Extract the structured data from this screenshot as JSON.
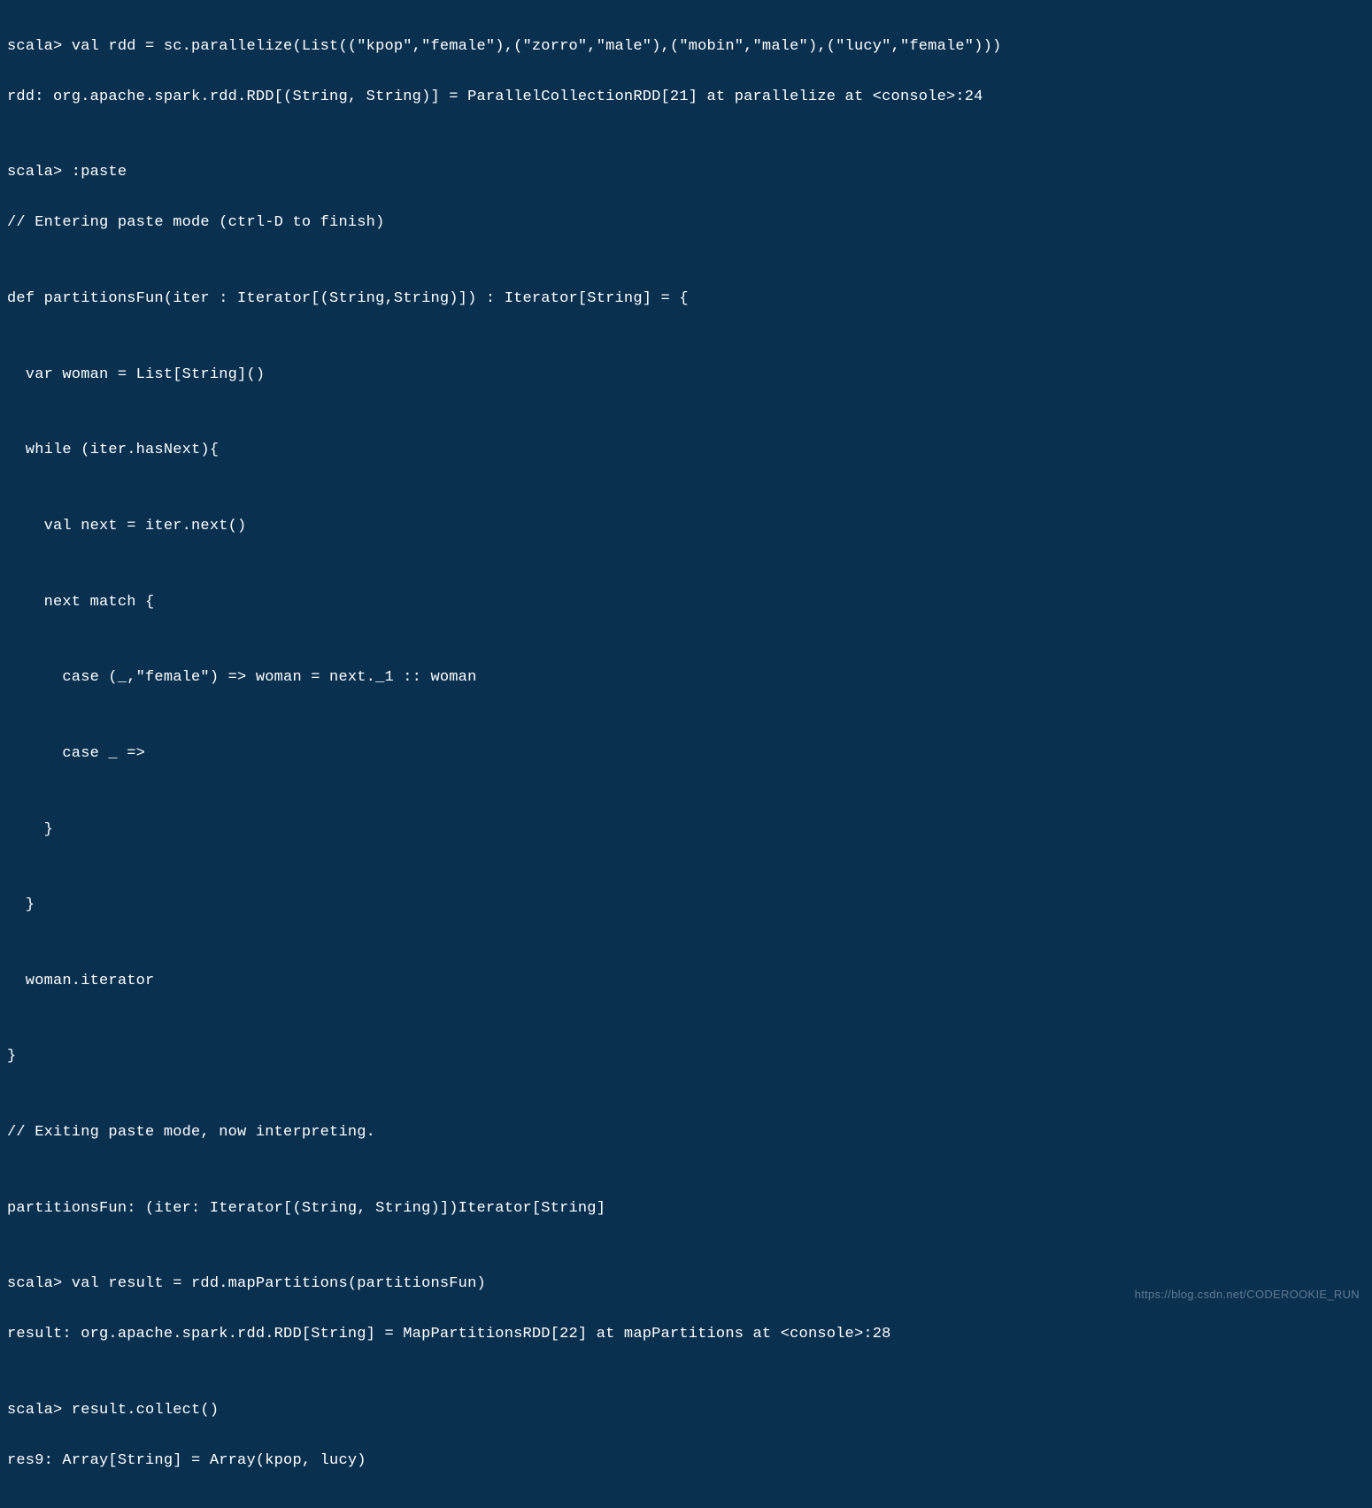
{
  "terminal": {
    "lines": [
      "scala> val rdd = sc.parallelize(List((\"kpop\",\"female\"),(\"zorro\",\"male\"),(\"mobin\",\"male\"),(\"lucy\",\"female\")))",
      "rdd: org.apache.spark.rdd.RDD[(String, String)] = ParallelCollectionRDD[21] at parallelize at <console>:24",
      "",
      "scala> :paste",
      "// Entering paste mode (ctrl-D to finish)",
      "",
      "def partitionsFun(iter : Iterator[(String,String)]) : Iterator[String] = {",
      "",
      "  var woman = List[String]()",
      "",
      "  while (iter.hasNext){",
      "",
      "    val next = iter.next()",
      "",
      "    next match {",
      "",
      "      case (_,\"female\") => woman = next._1 :: woman",
      "",
      "      case _ =>",
      "",
      "    }",
      "",
      "  }",
      "",
      "  woman.iterator",
      "",
      "}",
      "",
      "// Exiting paste mode, now interpreting.",
      "",
      "partitionsFun: (iter: Iterator[(String, String)])Iterator[String]",
      "",
      "scala> val result = rdd.mapPartitions(partitionsFun)",
      "result: org.apache.spark.rdd.RDD[String] = MapPartitionsRDD[22] at mapPartitions at <console>:28",
      "",
      "scala> result.collect()",
      "res9: Array[String] = Array(kpop, lucy)"
    ]
  },
  "watermark": {
    "text": "https://blog.csdn.net/CODEROOKIE_RUN"
  }
}
